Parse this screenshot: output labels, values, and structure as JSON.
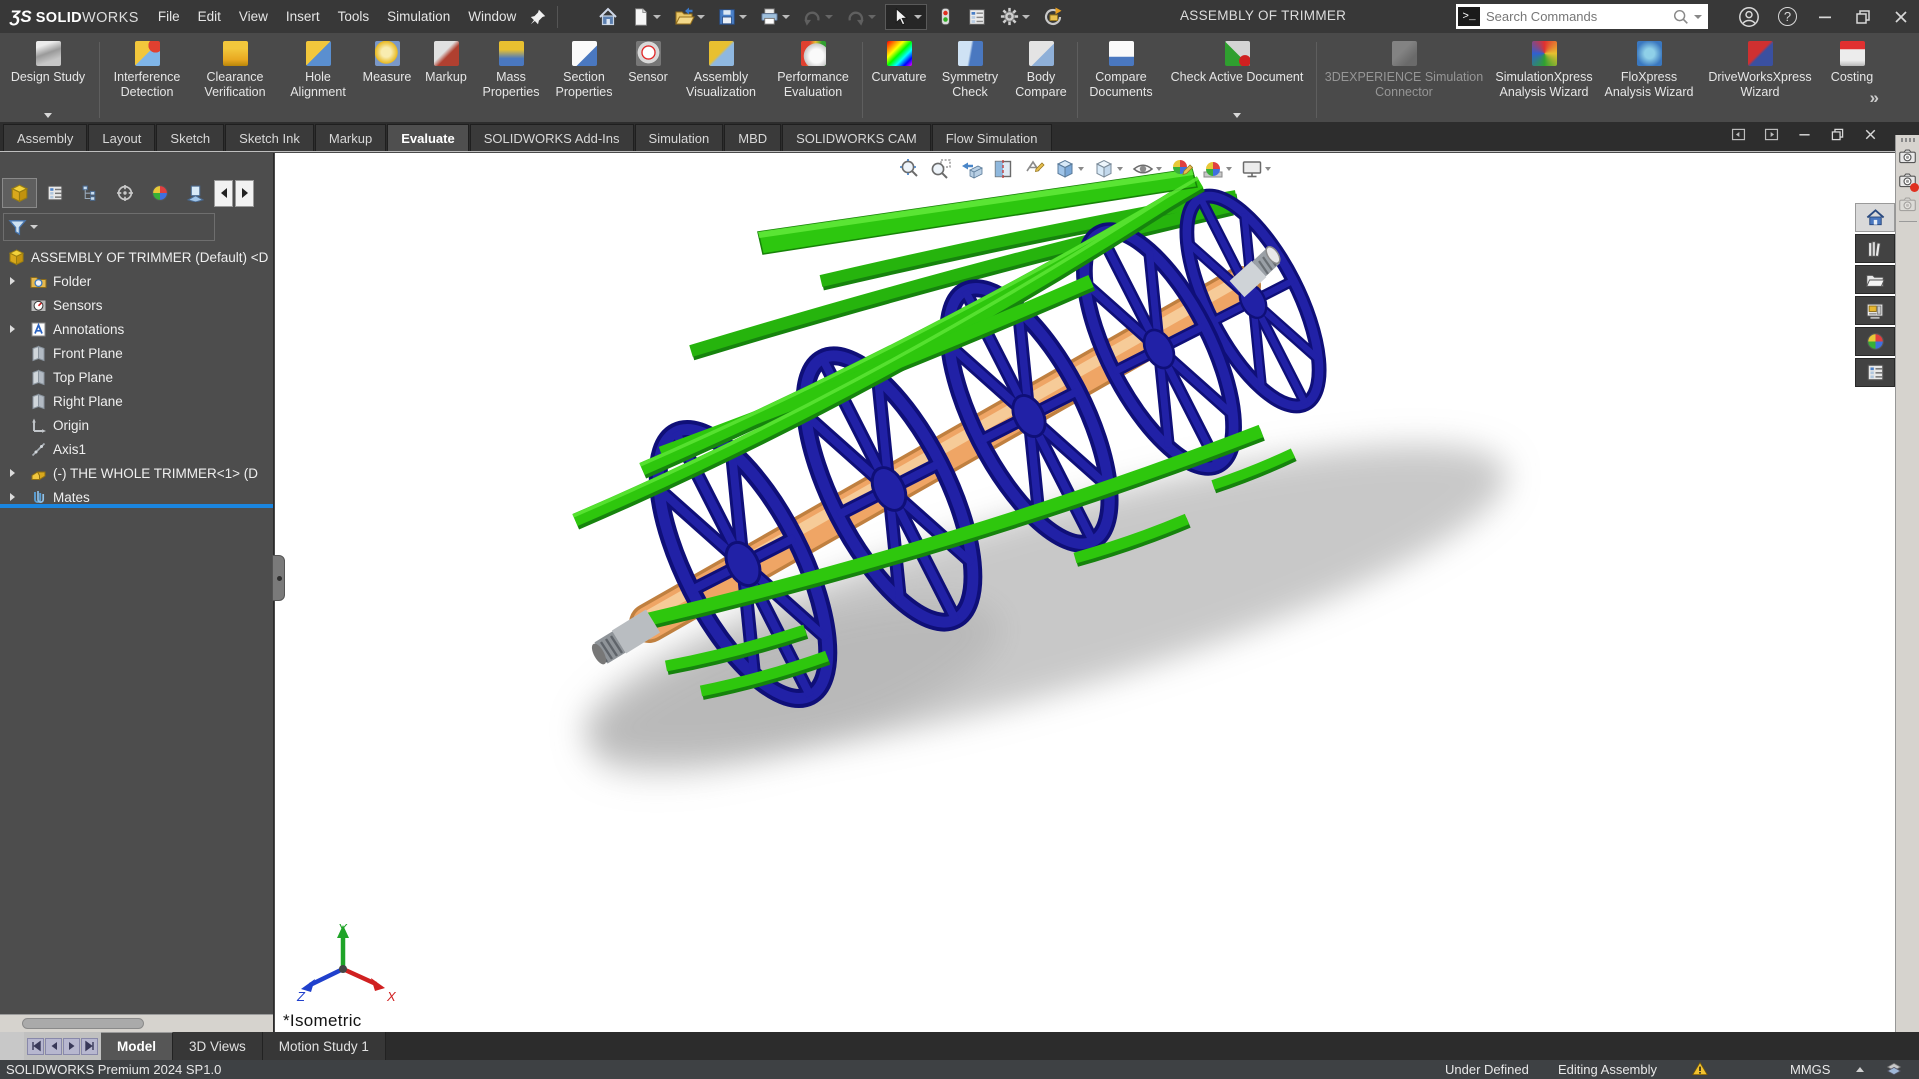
{
  "titlebar": {
    "logo_mark": "ƷS",
    "logo_solid": "SOLID",
    "logo_works": "WORKS",
    "menus": [
      "File",
      "Edit",
      "View",
      "Insert",
      "Tools",
      "Simulation",
      "Window"
    ],
    "document_title": "ASSEMBLY OF TRIMMER",
    "search": {
      "badge": ">_",
      "placeholder": "Search Commands"
    },
    "help_glyph": "?"
  },
  "ribbon": {
    "overflow_glyph": "»",
    "buttons": [
      {
        "label": "Design Study"
      },
      {
        "label": "Interference Detection"
      },
      {
        "label": "Clearance Verification"
      },
      {
        "label": "Hole Alignment"
      },
      {
        "label": "Measure"
      },
      {
        "label": "Markup"
      },
      {
        "label": "Mass Properties"
      },
      {
        "label": "Section Properties"
      },
      {
        "label": "Sensor"
      },
      {
        "label": "Assembly Visualization"
      },
      {
        "label": "Performance Evaluation"
      },
      {
        "label": "Curvature"
      },
      {
        "label": "Symmetry Check"
      },
      {
        "label": "Body Compare"
      },
      {
        "label": "Compare Documents"
      },
      {
        "label": "Check Active Document"
      },
      {
        "label": "3DEXPERIENCE Simulation Connector",
        "disabled": true
      },
      {
        "label": "SimulationXpress Analysis Wizard"
      },
      {
        "label": "FloXpress Analysis Wizard"
      },
      {
        "label": "DriveWorksXpress Wizard"
      },
      {
        "label": "Costing"
      }
    ]
  },
  "command_tabs": {
    "items": [
      "Assembly",
      "Layout",
      "Sketch",
      "Sketch Ink",
      "Markup",
      "Evaluate",
      "SOLIDWORKS Add-Ins",
      "Simulation",
      "MBD",
      "SOLIDWORKS CAM",
      "Flow Simulation"
    ],
    "active": "Evaluate"
  },
  "feature_tree": {
    "root_label": "ASSEMBLY OF TRIMMER (Default) <D",
    "items": [
      {
        "label": "Folder",
        "expandable": true
      },
      {
        "label": "Sensors",
        "expandable": false
      },
      {
        "label": "Annotations",
        "expandable": true
      },
      {
        "label": "Front Plane",
        "expandable": false
      },
      {
        "label": "Top Plane",
        "expandable": false
      },
      {
        "label": "Right Plane",
        "expandable": false
      },
      {
        "label": "Origin",
        "expandable": false
      },
      {
        "label": "Axis1",
        "expandable": false
      },
      {
        "label": "(-) THE WHOLE TRIMMER<1> (D",
        "expandable": true
      },
      {
        "label": "Mates",
        "expandable": true
      }
    ]
  },
  "viewport": {
    "orientation_label": "*Isometric",
    "triad": {
      "x": "X",
      "y": "Y",
      "z": "Z"
    }
  },
  "bottom_tabs": {
    "items": [
      "Model",
      "3D Views",
      "Motion Study 1"
    ],
    "active": "Model"
  },
  "statusbar": {
    "left_text": "SOLIDWORKS Premium 2024 SP1.0",
    "constraint_status": "Under Defined",
    "mode_text": "Editing Assembly",
    "units": "MMGS"
  },
  "model_colors": {
    "blade_green": "#2dc70f",
    "wheel_navy": "#2121a6",
    "shaft_orange": "#efa565",
    "accent_blue": "#1b86e0"
  }
}
